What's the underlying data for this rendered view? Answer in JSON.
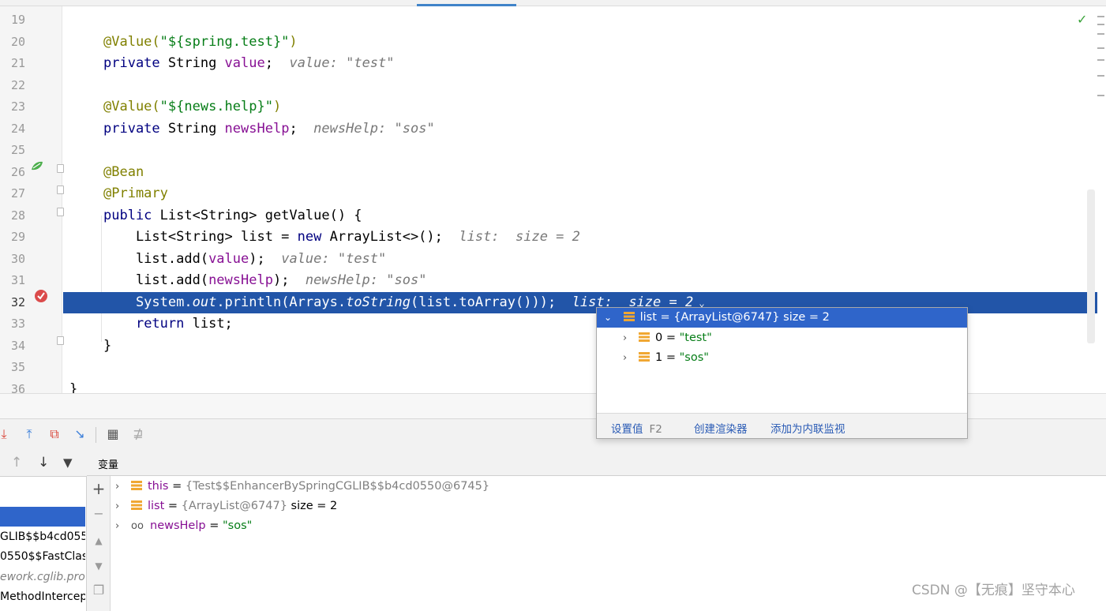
{
  "editor": {
    "lines": [
      {
        "n": "19",
        "parts": []
      },
      {
        "n": "20",
        "parts": [
          [
            "ann",
            "@Value("
          ],
          [
            "str",
            "\"${spring.test}\""
          ],
          [
            "ann",
            ")"
          ]
        ]
      },
      {
        "n": "21",
        "parts": [
          [
            "kw",
            "private "
          ],
          [
            "",
            "String "
          ],
          [
            "fld",
            "value"
          ],
          [
            "",
            ";  "
          ],
          [
            "hint",
            "value: \"test\""
          ]
        ]
      },
      {
        "n": "22",
        "parts": []
      },
      {
        "n": "23",
        "parts": [
          [
            "ann",
            "@Value("
          ],
          [
            "str",
            "\"${news.help}\""
          ],
          [
            "ann",
            ")"
          ]
        ]
      },
      {
        "n": "24",
        "parts": [
          [
            "kw",
            "private "
          ],
          [
            "",
            "String "
          ],
          [
            "fld",
            "newsHelp"
          ],
          [
            "",
            ";  "
          ],
          [
            "hint",
            "newsHelp: \"sos\""
          ]
        ]
      },
      {
        "n": "25",
        "parts": []
      },
      {
        "n": "26",
        "parts": [
          [
            "ann",
            "@Bean"
          ]
        ]
      },
      {
        "n": "27",
        "parts": [
          [
            "ann",
            "@Primary"
          ]
        ]
      },
      {
        "n": "28",
        "parts": [
          [
            "kw",
            "public "
          ],
          [
            "",
            "List<String> getValue() {"
          ]
        ]
      },
      {
        "n": "29",
        "parts": [
          [
            "",
            "    List<String> list = "
          ],
          [
            "kw",
            "new "
          ],
          [
            "",
            "ArrayList<>();  "
          ],
          [
            "hint",
            "list:  size = 2"
          ]
        ]
      },
      {
        "n": "30",
        "parts": [
          [
            "",
            "    list.add("
          ],
          [
            "fld",
            "value"
          ],
          [
            "",
            ");  "
          ],
          [
            "hint",
            "value: \"test\""
          ]
        ]
      },
      {
        "n": "31",
        "parts": [
          [
            "",
            "    list.add("
          ],
          [
            "fld",
            "newsHelp"
          ],
          [
            "",
            ");  "
          ],
          [
            "hint",
            "newsHelp: \"sos\""
          ]
        ]
      },
      {
        "n": "32",
        "parts": [
          [
            "",
            "    System."
          ],
          [
            "it",
            "out"
          ],
          [
            "",
            ".println(Arrays."
          ],
          [
            "it",
            "toString"
          ],
          [
            "",
            "(list.toArray()));  "
          ],
          [
            "hint",
            "list:  size = 2"
          ]
        ]
      },
      {
        "n": "33",
        "parts": [
          [
            "",
            "    "
          ],
          [
            "kw",
            "return "
          ],
          [
            "",
            "list;"
          ]
        ]
      },
      {
        "n": "34",
        "parts": [
          [
            "",
            "}"
          ]
        ]
      },
      {
        "n": "35",
        "parts": []
      },
      {
        "n": "36",
        "parts": [
          [
            "",
            "}"
          ]
        ]
      }
    ],
    "current_line": "32"
  },
  "popup": {
    "header": "list = {ArrayList@6747}  size = 2",
    "items": [
      {
        "label": "0 = ",
        "value": "\"test\""
      },
      {
        "label": "1 = ",
        "value": "\"sos\""
      }
    ],
    "set_value": "设置值",
    "set_value_key": "F2",
    "create_renderer": "创建渲染器",
    "add_inline_watch": "添加为内联监视"
  },
  "variables": {
    "title": "变量",
    "rows": [
      {
        "name": "this",
        "eq": " = ",
        "value": "{Test$$EnhancerBySpringCGLIB$$b4cd0550@6745}",
        "extra": ""
      },
      {
        "name": "list",
        "eq": " = ",
        "value": "{ArrayList@6747}",
        "extra": "  size = 2"
      },
      {
        "name": "newsHelp",
        "eq": " = ",
        "value": "",
        "extra": "\"sos\""
      }
    ]
  },
  "frames": [
    {
      "text": "",
      "style": "sel"
    },
    {
      "text": "GLIB$$b4cd055",
      "style": ""
    },
    {
      "text": "0550$$FastClas",
      "style": ""
    },
    {
      "text": "ework.cglib.pro",
      "style": "lib"
    },
    {
      "text": "MethodIntercep",
      "style": ""
    }
  ],
  "watermark": "CSDN @【无痕】坚守本心",
  "colors": {
    "current_line": "#2255a8",
    "selection": "#2f65ca",
    "annotation": "#808000",
    "keyword": "#000080",
    "string": "#067d17",
    "field": "#871094"
  }
}
